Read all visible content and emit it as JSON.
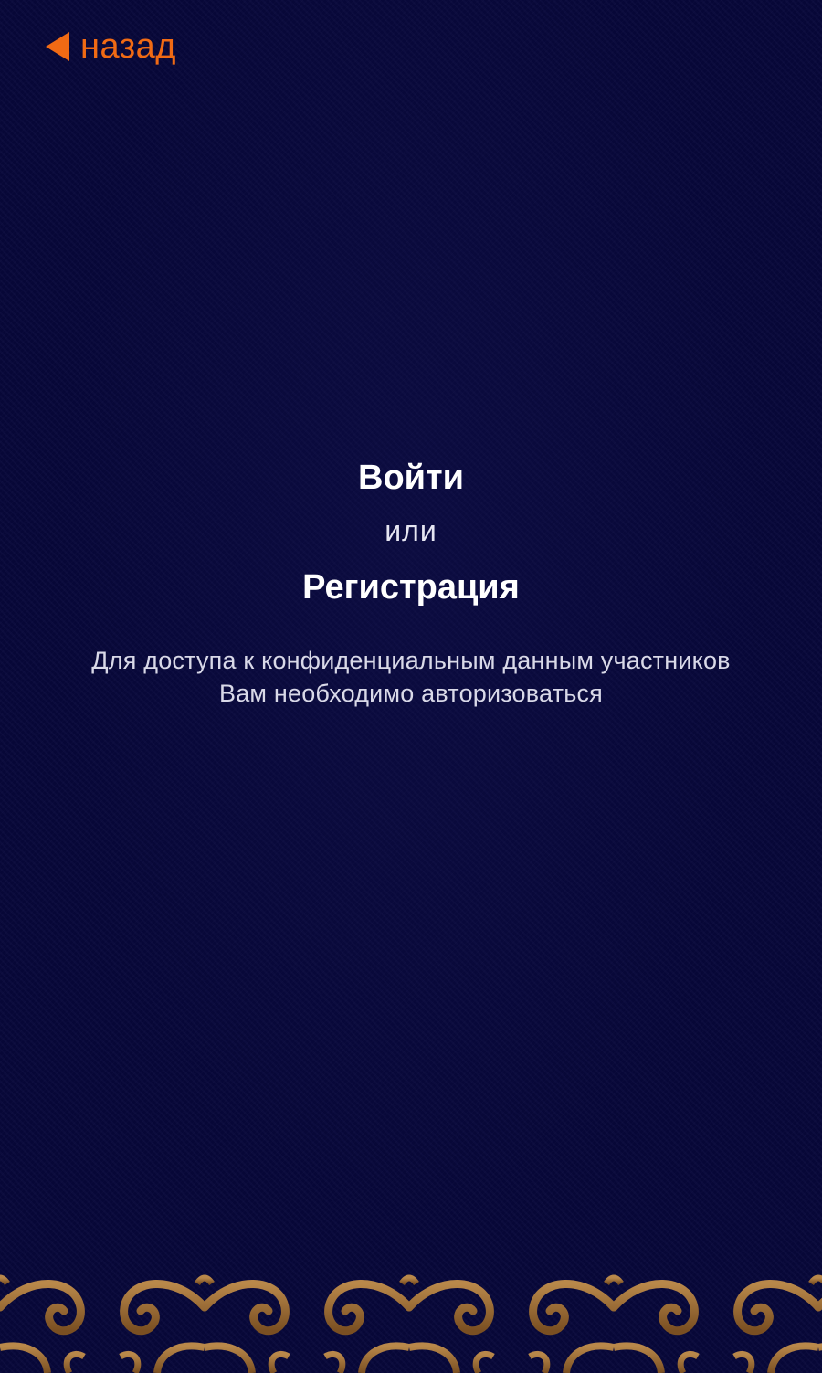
{
  "nav": {
    "back_label": "назад",
    "back_icon": "triangle-left-icon"
  },
  "auth": {
    "login_label": "Войти",
    "or_label": "или",
    "register_label": "Регистрация",
    "info_text": "Для доступа к конфиденциальным данным участников Вам необходимо авторизоваться"
  },
  "colors": {
    "background": "#07073a",
    "accent": "#f06a14",
    "ornament": "#9a6a32"
  },
  "decoration": {
    "ornament_icon": "kazakh-ornament-border"
  }
}
